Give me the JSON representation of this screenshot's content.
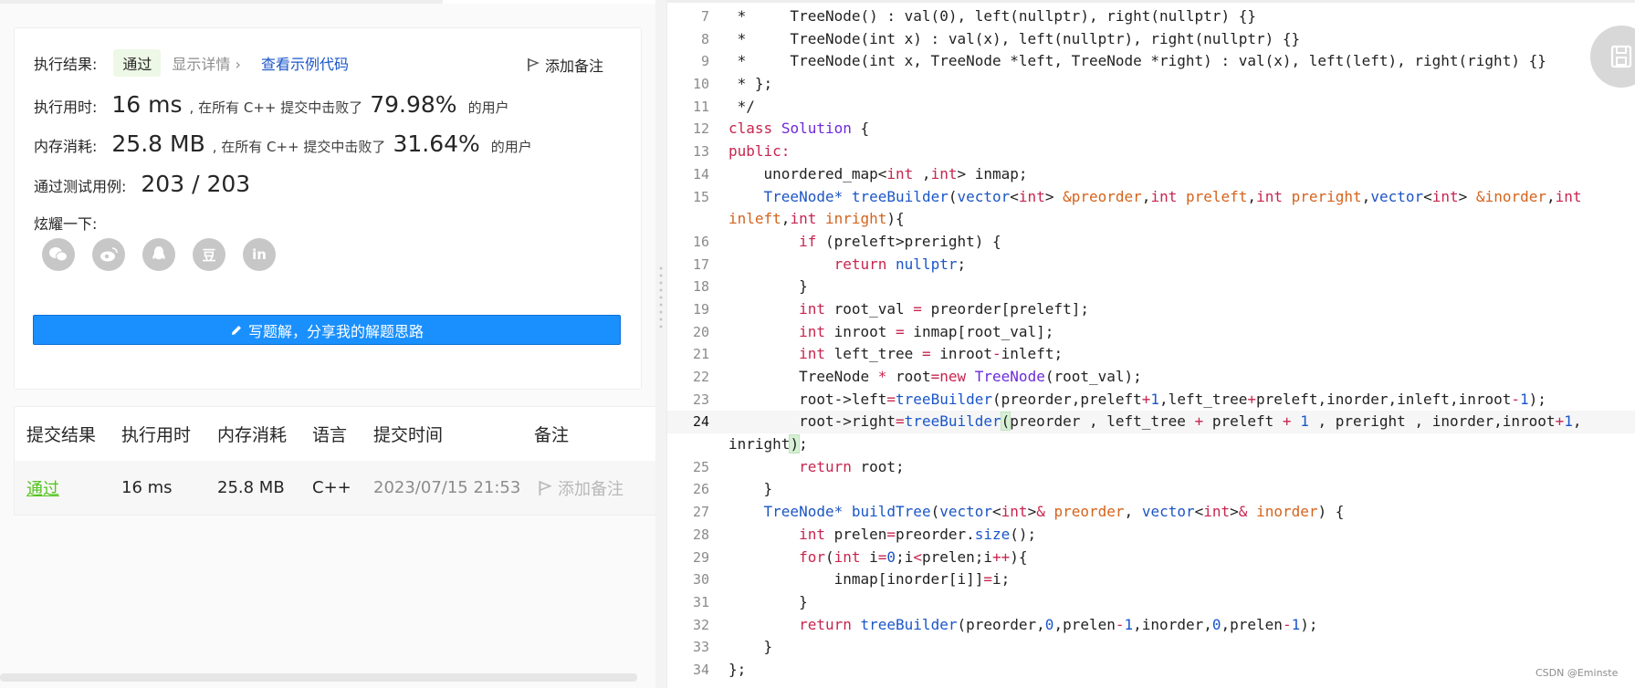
{
  "result": {
    "label": "执行结果:",
    "status": "通过",
    "detail": "显示详情",
    "detail_chevron": "›",
    "sample_link": "查看示例代码",
    "note_button": "添加备注",
    "runtime_label": "执行用时:",
    "runtime_value": "16 ms",
    "runtime_text": ", 在所有 C++ 提交中击败了",
    "runtime_percent": "79.98%",
    "runtime_suffix": "的用户",
    "memory_label": "内存消耗:",
    "memory_value": "25.8 MB",
    "memory_text": ", 在所有 C++ 提交中击败了",
    "memory_percent": "31.64%",
    "memory_suffix": "的用户",
    "tests_label": "通过测试用例:",
    "tests_value": "203 / 203",
    "share_label": "炫耀一下:",
    "share_icons": [
      "wechat-icon",
      "weibo-icon",
      "qq-icon",
      "douban-icon",
      "linkedin-icon"
    ],
    "douban_glyph": "豆",
    "linkedin_glyph": "in",
    "write_button": "写题解，分享我的解题思路"
  },
  "history": {
    "headers": [
      "提交结果",
      "执行用时",
      "内存消耗",
      "语言",
      "提交时间",
      "备注"
    ],
    "row": {
      "status": "通过",
      "runtime": "16 ms",
      "memory": "25.8 MB",
      "language": "C++",
      "time": "2023/07/15 21:53",
      "note": "添加备注"
    }
  },
  "code": {
    "line_numbers": [
      "7",
      "8",
      "9",
      "10",
      "11",
      "12",
      "13",
      "14",
      "15",
      "",
      "16",
      "17",
      "18",
      "19",
      "20",
      "21",
      "22",
      "23",
      "24",
      "",
      "25",
      "26",
      "27",
      "28",
      "29",
      "30",
      "31",
      "32",
      "33",
      "34"
    ],
    "active_line": "24"
  },
  "colors": {
    "accent_blue": "#1a90ff",
    "pass_green": "#52c41a",
    "keyword": "#c7254e",
    "type": "#1d55c2",
    "param": "#d4631c"
  },
  "watermark": "CSDN @Eminste"
}
